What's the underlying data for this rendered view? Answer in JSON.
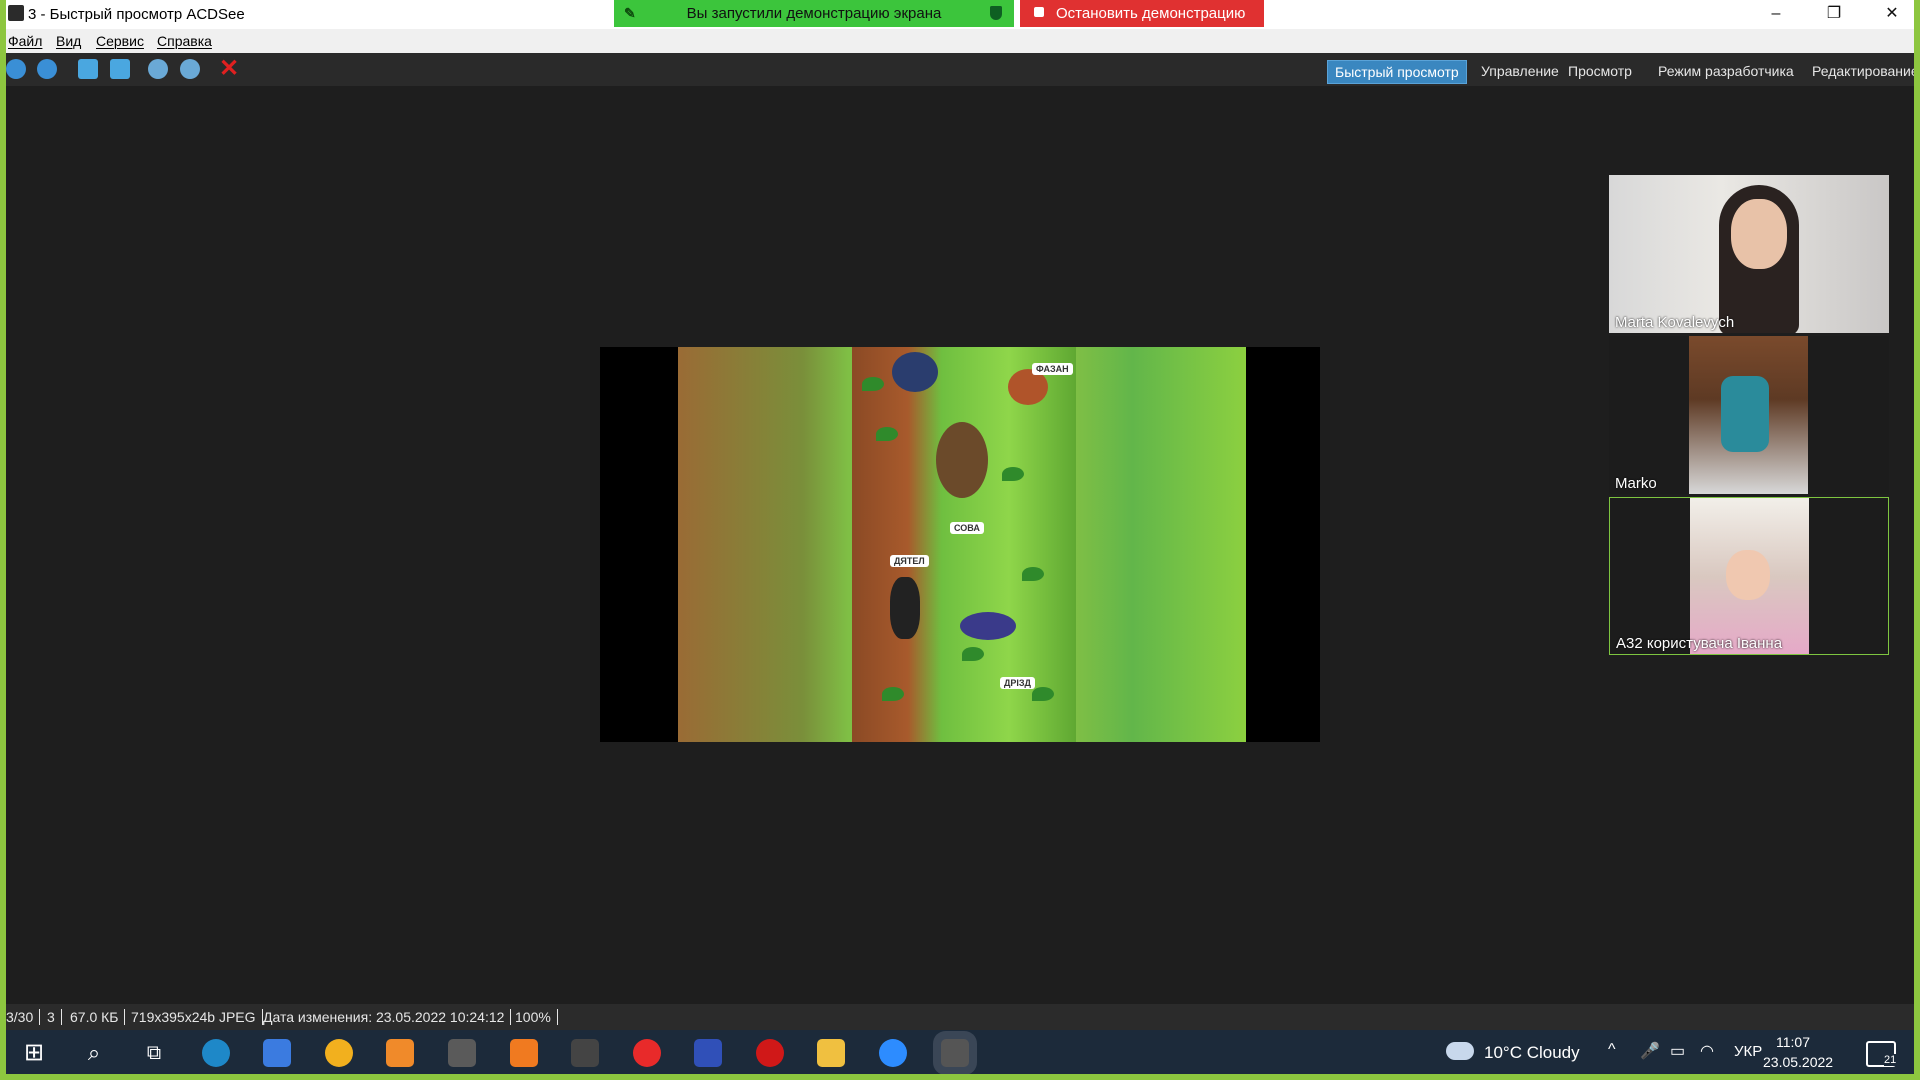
{
  "titlebar": {
    "title": "3 - Быстрый просмотр ACDSee",
    "share_banner": "Вы запустили демонстрацию экрана",
    "stop_share": "Остановить демонстрацию",
    "minimize": "–",
    "restore": "❐",
    "close": "✕"
  },
  "menu": {
    "file": "Файл",
    "view": "Вид",
    "service": "Сервис",
    "help": "Справка"
  },
  "modes": {
    "quick_view": "Быстрый просмотр",
    "manage": "Управление",
    "view": "Просмотр",
    "developer": "Режим разработчика",
    "edit": "Редактирование"
  },
  "image_labels": {
    "pheasant": "ФАЗАН",
    "owl": "СОВА",
    "woodpecker": "ДЯТЕЛ",
    "thrush": "ДРІЗД"
  },
  "participants": [
    {
      "name": "Marta Kovalevych"
    },
    {
      "name": "Marko"
    },
    {
      "name": "А32 користувача Іванна"
    }
  ],
  "status": {
    "index": "3/30",
    "name": "3",
    "size": "67.0 КБ",
    "dims": "719x395x24b JPEG",
    "modified": "Дата изменения: 23.05.2022 10:24:12",
    "zoom": "100%"
  },
  "taskbar": {
    "weather": "10°C  Cloudy",
    "lang": "УКР",
    "time": "11:07",
    "date": "23.05.2022",
    "notifications": "21"
  },
  "colors": {
    "accent": "#3a87c0",
    "share_green": "#3cc53c",
    "stop_red": "#e03131",
    "frame_green": "#8dc63f"
  }
}
